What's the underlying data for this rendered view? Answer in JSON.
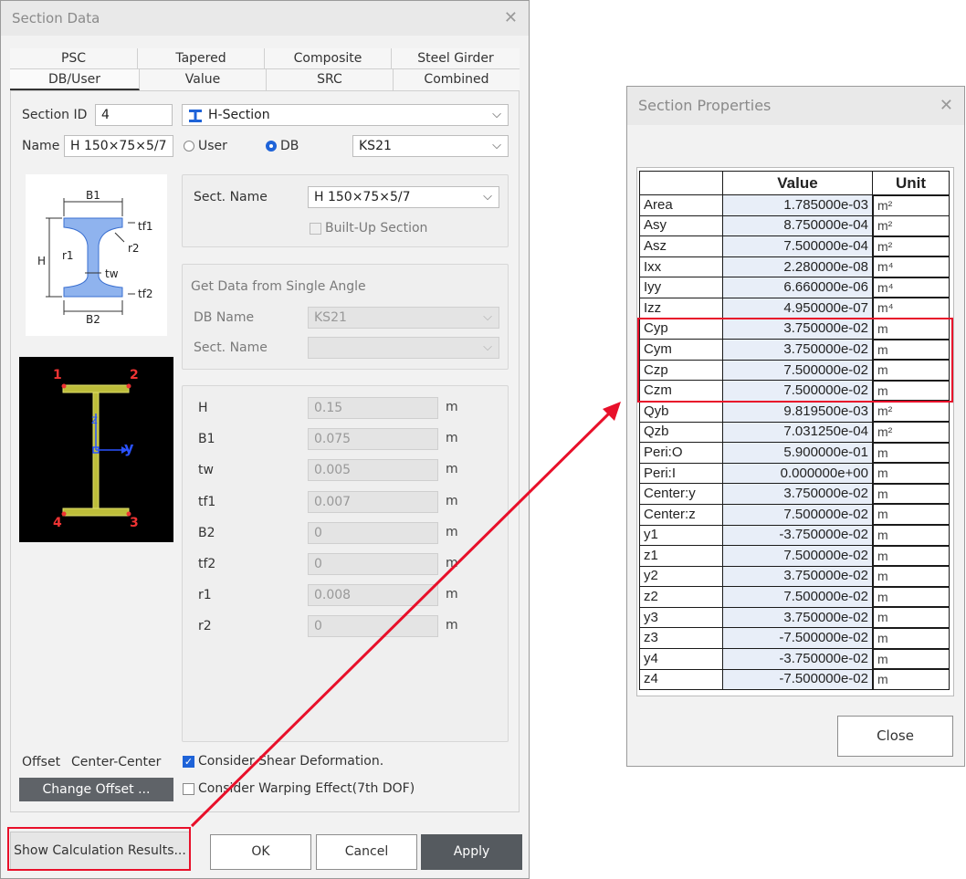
{
  "section_dialog": {
    "title": "Section Data",
    "tabs_row1": [
      "PSC",
      "Tapered",
      "Composite",
      "Steel Girder"
    ],
    "tabs_row2": [
      "DB/User",
      "Value",
      "SRC",
      "Combined"
    ],
    "section_id_label": "Section ID",
    "section_id_value": "4",
    "section_type": "H-Section",
    "name_label": "Name",
    "name_value": "H 150×75×5/7",
    "radio_user": "User",
    "radio_db": "DB",
    "db_value": "KS21",
    "diagram_labels": {
      "b1": "B1",
      "tf1": "tf1",
      "r1": "r1",
      "r2": "r2",
      "h": "H",
      "tw": "tw",
      "tf2": "tf2",
      "b2": "B2"
    },
    "preview_labels": {
      "p1": "1",
      "p2": "2",
      "p3": "3",
      "p4": "4",
      "z": "z",
      "y": "y"
    },
    "sect_name_label": "Sect. Name",
    "sect_name_value": "H 150×75×5/7",
    "built_up_label": "Built-Up Section",
    "single_angle_title": "Get Data from Single Angle",
    "db_name_label": "DB Name",
    "db_name_value": "KS21",
    "sect_name2_label": "Sect. Name",
    "dims": [
      {
        "label": "H",
        "value": "0.15",
        "unit": "m"
      },
      {
        "label": "B1",
        "value": "0.075",
        "unit": "m"
      },
      {
        "label": "tw",
        "value": "0.005",
        "unit": "m"
      },
      {
        "label": "tf1",
        "value": "0.007",
        "unit": "m"
      },
      {
        "label": "B2",
        "value": "0",
        "unit": "m"
      },
      {
        "label": "tf2",
        "value": "0",
        "unit": "m"
      },
      {
        "label": "r1",
        "value": "0.008",
        "unit": "m"
      },
      {
        "label": "r2",
        "value": "0",
        "unit": "m"
      }
    ],
    "offset_label": "Offset",
    "offset_value": "Center-Center",
    "change_offset_label": "Change Offset ...",
    "shear_label": "Consider Shear Deformation.",
    "warping_label": "Consider Warping Effect(7th DOF)",
    "show_calc_label": "Show Calculation Results...",
    "ok_label": "OK",
    "cancel_label": "Cancel",
    "apply_label": "Apply"
  },
  "props_dialog": {
    "title": "Section Properties",
    "col_value": "Value",
    "col_unit": "Unit",
    "rows": [
      {
        "name": "Area",
        "value": "1.785000e-03",
        "unit": "m²"
      },
      {
        "name": "Asy",
        "value": "8.750000e-04",
        "unit": "m²"
      },
      {
        "name": "Asz",
        "value": "7.500000e-04",
        "unit": "m²"
      },
      {
        "name": "Ixx",
        "value": "2.280000e-08",
        "unit": "m⁴"
      },
      {
        "name": "Iyy",
        "value": "6.660000e-06",
        "unit": "m⁴"
      },
      {
        "name": "Izz",
        "value": "4.950000e-07",
        "unit": "m⁴"
      },
      {
        "name": "Cyp",
        "value": "3.750000e-02",
        "unit": "m"
      },
      {
        "name": "Cym",
        "value": "3.750000e-02",
        "unit": "m"
      },
      {
        "name": "Czp",
        "value": "7.500000e-02",
        "unit": "m"
      },
      {
        "name": "Czm",
        "value": "7.500000e-02",
        "unit": "m"
      },
      {
        "name": "Qyb",
        "value": "9.819500e-03",
        "unit": "m²"
      },
      {
        "name": "Qzb",
        "value": "7.031250e-04",
        "unit": "m²"
      },
      {
        "name": "Peri:O",
        "value": "5.900000e-01",
        "unit": "m"
      },
      {
        "name": "Peri:I",
        "value": "0.000000e+00",
        "unit": "m"
      },
      {
        "name": "Center:y",
        "value": "3.750000e-02",
        "unit": "m"
      },
      {
        "name": "Center:z",
        "value": "7.500000e-02",
        "unit": "m"
      },
      {
        "name": "y1",
        "value": "-3.750000e-02",
        "unit": "m"
      },
      {
        "name": "z1",
        "value": "7.500000e-02",
        "unit": "m"
      },
      {
        "name": "y2",
        "value": "3.750000e-02",
        "unit": "m"
      },
      {
        "name": "z2",
        "value": "7.500000e-02",
        "unit": "m"
      },
      {
        "name": "y3",
        "value": "3.750000e-02",
        "unit": "m"
      },
      {
        "name": "z3",
        "value": "-7.500000e-02",
        "unit": "m"
      },
      {
        "name": "y4",
        "value": "-3.750000e-02",
        "unit": "m"
      },
      {
        "name": "z4",
        "value": "-7.500000e-02",
        "unit": "m"
      }
    ],
    "close_label": "Close"
  },
  "colors": {
    "highlight": "#e8102a",
    "accent": "#1e63d8",
    "beam_fill": "#8fb3ee"
  }
}
